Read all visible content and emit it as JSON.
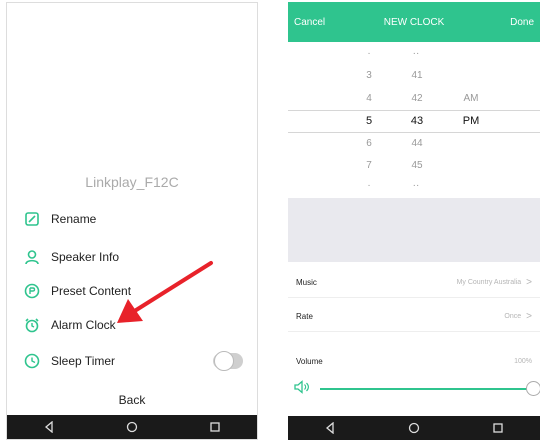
{
  "left": {
    "device_name": "Linkplay_F12C",
    "menu": [
      {
        "label": "Rename",
        "icon": "edit-icon"
      },
      {
        "label": "Speaker Info",
        "icon": "person-icon"
      },
      {
        "label": "Preset Content",
        "icon": "preset-icon"
      },
      {
        "label": "Alarm Clock",
        "icon": "alarm-clock-icon"
      },
      {
        "label": "Sleep Timer",
        "icon": "timer-icon"
      }
    ],
    "sleep_timer_on": false,
    "back_label": "Back"
  },
  "right": {
    "header": {
      "cancel": "Cancel",
      "title": "NEW CLOCK",
      "done": "Done"
    },
    "picker": {
      "hours": [
        "3",
        "4",
        "5",
        "6",
        "7"
      ],
      "minutes": [
        "41",
        "42",
        "43",
        "44",
        "45"
      ],
      "ampm": [
        "AM",
        "PM"
      ],
      "selected_hour": "5",
      "selected_minute": "43",
      "selected_ampm": "PM"
    },
    "settings": {
      "music_label": "Music",
      "music_value": "My Country Australia",
      "rate_label": "Rate",
      "rate_value": "Once",
      "volume_label": "Volume",
      "volume_value": "100%"
    },
    "volume_fraction": 1.0
  },
  "colors": {
    "accent": "#2fc48e",
    "arrow": "#e8222a",
    "navbar": "#1a1a1a"
  }
}
